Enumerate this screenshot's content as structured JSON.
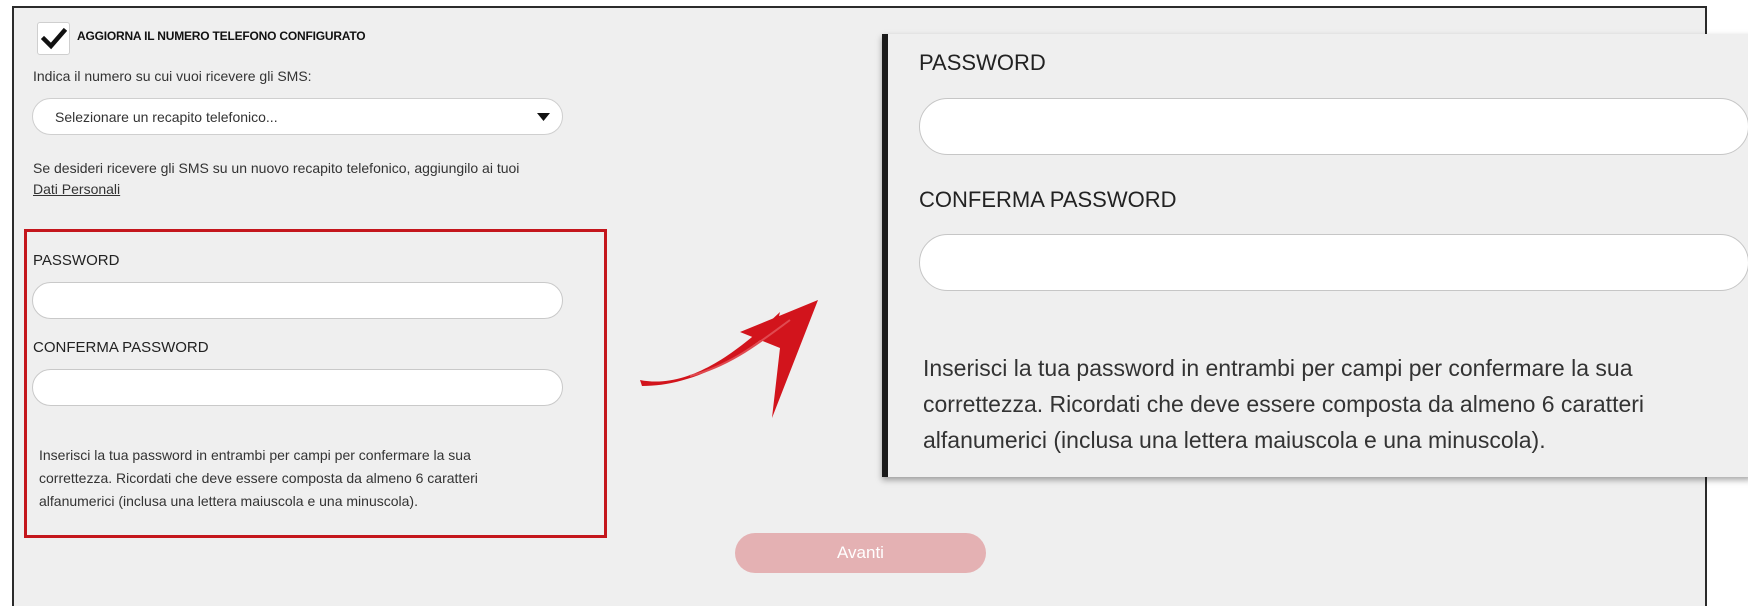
{
  "checkbox": {
    "label": "AGGIORNA IL NUMERO TELEFONO CONFIGURATO",
    "checked": true
  },
  "sms_prompt": "Indica il numero su cui vuoi ricevere gli SMS:",
  "phone_select": {
    "value": "Selezionare un recapito telefonico..."
  },
  "new_number_note": {
    "text": "Se desideri ricevere gli SMS su un nuovo recapito telefonico, aggiungilo ai tuoi",
    "link": "Dati Personali"
  },
  "password": {
    "label": "PASSWORD",
    "confirm_label": "CONFERMA PASSWORD",
    "help_lines": [
      "Inserisci la tua password in entrambi per campi per confermare la sua",
      "correttezza. Ricordati che deve essere composta da almeno 6 caratteri",
      "alfanumerici (inclusa una lettera maiuscola e una minuscola)."
    ]
  },
  "submit": {
    "label": "Avanti",
    "enabled": false
  },
  "colors": {
    "highlight_border": "#c4161c",
    "arrow": "#d2141c",
    "button_disabled": "#e4b1b3",
    "panel_background": "#efefef"
  }
}
